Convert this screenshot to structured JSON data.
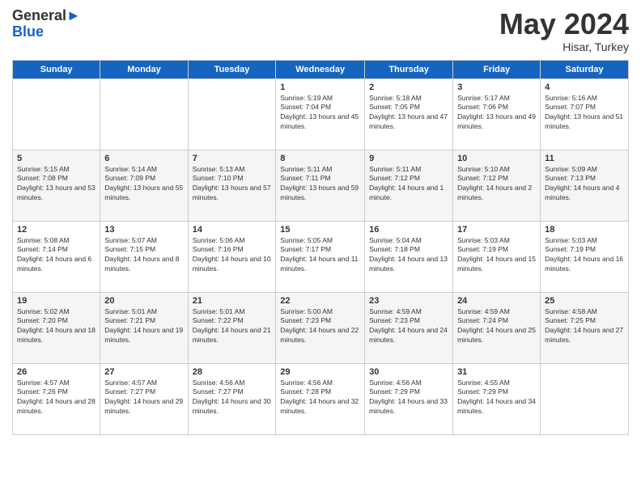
{
  "logo": {
    "general": "General",
    "blue": "Blue"
  },
  "header": {
    "month": "May 2024",
    "location": "Hisar, Turkey"
  },
  "weekdays": [
    "Sunday",
    "Monday",
    "Tuesday",
    "Wednesday",
    "Thursday",
    "Friday",
    "Saturday"
  ],
  "weeks": [
    [
      {
        "day": "",
        "sunrise": "",
        "sunset": "",
        "daylight": ""
      },
      {
        "day": "",
        "sunrise": "",
        "sunset": "",
        "daylight": ""
      },
      {
        "day": "",
        "sunrise": "",
        "sunset": "",
        "daylight": ""
      },
      {
        "day": "1",
        "sunrise": "Sunrise: 5:19 AM",
        "sunset": "Sunset: 7:04 PM",
        "daylight": "Daylight: 13 hours and 45 minutes."
      },
      {
        "day": "2",
        "sunrise": "Sunrise: 5:18 AM",
        "sunset": "Sunset: 7:05 PM",
        "daylight": "Daylight: 13 hours and 47 minutes."
      },
      {
        "day": "3",
        "sunrise": "Sunrise: 5:17 AM",
        "sunset": "Sunset: 7:06 PM",
        "daylight": "Daylight: 13 hours and 49 minutes."
      },
      {
        "day": "4",
        "sunrise": "Sunrise: 5:16 AM",
        "sunset": "Sunset: 7:07 PM",
        "daylight": "Daylight: 13 hours and 51 minutes."
      }
    ],
    [
      {
        "day": "5",
        "sunrise": "Sunrise: 5:15 AM",
        "sunset": "Sunset: 7:08 PM",
        "daylight": "Daylight: 13 hours and 53 minutes."
      },
      {
        "day": "6",
        "sunrise": "Sunrise: 5:14 AM",
        "sunset": "Sunset: 7:09 PM",
        "daylight": "Daylight: 13 hours and 55 minutes."
      },
      {
        "day": "7",
        "sunrise": "Sunrise: 5:13 AM",
        "sunset": "Sunset: 7:10 PM",
        "daylight": "Daylight: 13 hours and 57 minutes."
      },
      {
        "day": "8",
        "sunrise": "Sunrise: 5:11 AM",
        "sunset": "Sunset: 7:11 PM",
        "daylight": "Daylight: 13 hours and 59 minutes."
      },
      {
        "day": "9",
        "sunrise": "Sunrise: 5:11 AM",
        "sunset": "Sunset: 7:12 PM",
        "daylight": "Daylight: 14 hours and 1 minute."
      },
      {
        "day": "10",
        "sunrise": "Sunrise: 5:10 AM",
        "sunset": "Sunset: 7:12 PM",
        "daylight": "Daylight: 14 hours and 2 minutes."
      },
      {
        "day": "11",
        "sunrise": "Sunrise: 5:09 AM",
        "sunset": "Sunset: 7:13 PM",
        "daylight": "Daylight: 14 hours and 4 minutes."
      }
    ],
    [
      {
        "day": "12",
        "sunrise": "Sunrise: 5:08 AM",
        "sunset": "Sunset: 7:14 PM",
        "daylight": "Daylight: 14 hours and 6 minutes."
      },
      {
        "day": "13",
        "sunrise": "Sunrise: 5:07 AM",
        "sunset": "Sunset: 7:15 PM",
        "daylight": "Daylight: 14 hours and 8 minutes."
      },
      {
        "day": "14",
        "sunrise": "Sunrise: 5:06 AM",
        "sunset": "Sunset: 7:16 PM",
        "daylight": "Daylight: 14 hours and 10 minutes."
      },
      {
        "day": "15",
        "sunrise": "Sunrise: 5:05 AM",
        "sunset": "Sunset: 7:17 PM",
        "daylight": "Daylight: 14 hours and 11 minutes."
      },
      {
        "day": "16",
        "sunrise": "Sunrise: 5:04 AM",
        "sunset": "Sunset: 7:18 PM",
        "daylight": "Daylight: 14 hours and 13 minutes."
      },
      {
        "day": "17",
        "sunrise": "Sunrise: 5:03 AM",
        "sunset": "Sunset: 7:19 PM",
        "daylight": "Daylight: 14 hours and 15 minutes."
      },
      {
        "day": "18",
        "sunrise": "Sunrise: 5:03 AM",
        "sunset": "Sunset: 7:19 PM",
        "daylight": "Daylight: 14 hours and 16 minutes."
      }
    ],
    [
      {
        "day": "19",
        "sunrise": "Sunrise: 5:02 AM",
        "sunset": "Sunset: 7:20 PM",
        "daylight": "Daylight: 14 hours and 18 minutes."
      },
      {
        "day": "20",
        "sunrise": "Sunrise: 5:01 AM",
        "sunset": "Sunset: 7:21 PM",
        "daylight": "Daylight: 14 hours and 19 minutes."
      },
      {
        "day": "21",
        "sunrise": "Sunrise: 5:01 AM",
        "sunset": "Sunset: 7:22 PM",
        "daylight": "Daylight: 14 hours and 21 minutes."
      },
      {
        "day": "22",
        "sunrise": "Sunrise: 5:00 AM",
        "sunset": "Sunset: 7:23 PM",
        "daylight": "Daylight: 14 hours and 22 minutes."
      },
      {
        "day": "23",
        "sunrise": "Sunrise: 4:59 AM",
        "sunset": "Sunset: 7:23 PM",
        "daylight": "Daylight: 14 hours and 24 minutes."
      },
      {
        "day": "24",
        "sunrise": "Sunrise: 4:59 AM",
        "sunset": "Sunset: 7:24 PM",
        "daylight": "Daylight: 14 hours and 25 minutes."
      },
      {
        "day": "25",
        "sunrise": "Sunrise: 4:58 AM",
        "sunset": "Sunset: 7:25 PM",
        "daylight": "Daylight: 14 hours and 27 minutes."
      }
    ],
    [
      {
        "day": "26",
        "sunrise": "Sunrise: 4:57 AM",
        "sunset": "Sunset: 7:26 PM",
        "daylight": "Daylight: 14 hours and 28 minutes."
      },
      {
        "day": "27",
        "sunrise": "Sunrise: 4:57 AM",
        "sunset": "Sunset: 7:27 PM",
        "daylight": "Daylight: 14 hours and 29 minutes."
      },
      {
        "day": "28",
        "sunrise": "Sunrise: 4:56 AM",
        "sunset": "Sunset: 7:27 PM",
        "daylight": "Daylight: 14 hours and 30 minutes."
      },
      {
        "day": "29",
        "sunrise": "Sunrise: 4:56 AM",
        "sunset": "Sunset: 7:28 PM",
        "daylight": "Daylight: 14 hours and 32 minutes."
      },
      {
        "day": "30",
        "sunrise": "Sunrise: 4:56 AM",
        "sunset": "Sunset: 7:29 PM",
        "daylight": "Daylight: 14 hours and 33 minutes."
      },
      {
        "day": "31",
        "sunrise": "Sunrise: 4:55 AM",
        "sunset": "Sunset: 7:29 PM",
        "daylight": "Daylight: 14 hours and 34 minutes."
      },
      {
        "day": "",
        "sunrise": "",
        "sunset": "",
        "daylight": ""
      }
    ]
  ]
}
